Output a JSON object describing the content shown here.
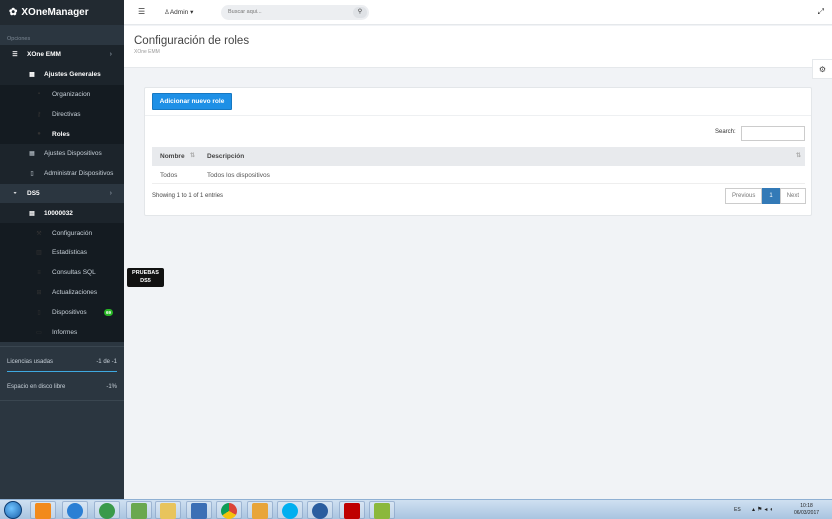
{
  "app": {
    "brand": "XOneManager"
  },
  "sidebar": {
    "section_label": "Opciones",
    "xone": {
      "label": "XOne EMM",
      "icon": "list-icon"
    },
    "ajustes_generales": {
      "label": "Ajustes Generales",
      "icon": "table-icon"
    },
    "organizacion": {
      "label": "Organizacion",
      "icon": "building-icon"
    },
    "directivas": {
      "label": "Directivas",
      "icon": "key-icon"
    },
    "roles": {
      "label": "Roles",
      "icon": "group-icon"
    },
    "ajustes_dispositivos": {
      "label": "Ajustes Dispositivos",
      "icon": "table-icon"
    },
    "administrar": {
      "label": "Administrar Dispositivos",
      "icon": "mobile-icon"
    },
    "ds5": {
      "label": "DS5",
      "icon": "dashboard-icon"
    },
    "server": {
      "label": "10000032",
      "icon": "server-icon"
    },
    "configuracion": {
      "label": "Configuración",
      "icon": "wrench-icon"
    },
    "estadisticas": {
      "label": "Estadísticas",
      "icon": "chart-icon"
    },
    "consultas": {
      "label": "Consultas SQL",
      "icon": "database-icon"
    },
    "actualizaciones": {
      "label": "Actualizaciones",
      "icon": "sitemap-icon"
    },
    "dispositivos": {
      "label": "Dispositivos",
      "icon": "mobile-icon",
      "badge": "69"
    },
    "informes": {
      "label": "Informes",
      "icon": "file-icon"
    },
    "licencias": {
      "label": "Licencias usadas",
      "value": "-1 de -1"
    },
    "disco": {
      "label": "Espacio en disco libre",
      "value": "-1%"
    }
  },
  "topbar": {
    "user": "Admin",
    "search_placeholder": "Buscar aqui..."
  },
  "page": {
    "title": "Configuración de roles",
    "subtitle": "XOne EMM"
  },
  "panel": {
    "add_button": "Adicionar nuevo role",
    "search_label": "Search:",
    "columns": [
      "Nombre",
      "Descripción"
    ],
    "rows": [
      {
        "nombre": "Todos",
        "descripcion": "Todos los dispositivos"
      }
    ],
    "info": "Showing 1 to 1 of 1 entries",
    "pagination": {
      "previous": "Previous",
      "current": "1",
      "next": "Next"
    }
  },
  "tooltip": {
    "line1": "PRUEBAS",
    "line2": "DS5"
  },
  "taskbar": {
    "lang": "ES",
    "time": "10:18",
    "date": "06/03/2017"
  }
}
